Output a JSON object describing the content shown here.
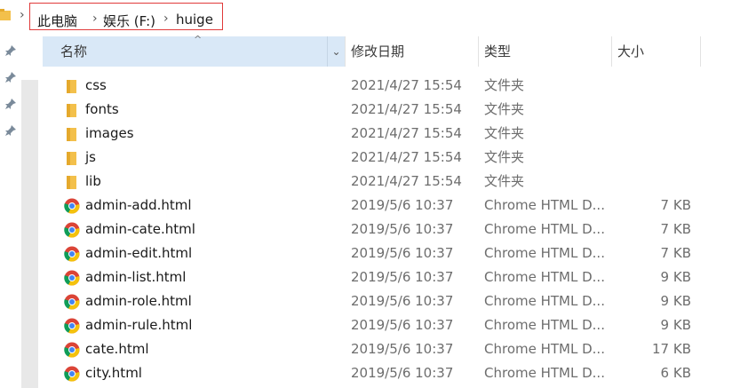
{
  "breadcrumb": {
    "items": [
      "此电脑",
      "娱乐 (F:)",
      "huige"
    ]
  },
  "columns": {
    "name": "名称",
    "modified": "修改日期",
    "type": "类型",
    "size": "大小"
  },
  "files": [
    {
      "name": "css",
      "modified": "2021/4/27 15:54",
      "type": "文件夹",
      "size": "",
      "icon": "folder-icon"
    },
    {
      "name": "fonts",
      "modified": "2021/4/27 15:54",
      "type": "文件夹",
      "size": "",
      "icon": "folder-icon"
    },
    {
      "name": "images",
      "modified": "2021/4/27 15:54",
      "type": "文件夹",
      "size": "",
      "icon": "folder-icon"
    },
    {
      "name": "js",
      "modified": "2021/4/27 15:54",
      "type": "文件夹",
      "size": "",
      "icon": "folder-icon"
    },
    {
      "name": "lib",
      "modified": "2021/4/27 15:54",
      "type": "文件夹",
      "size": "",
      "icon": "folder-icon"
    },
    {
      "name": "admin-add.html",
      "modified": "2019/5/6 10:37",
      "type": "Chrome HTML D...",
      "size": "7 KB",
      "icon": "chrome-html-icon"
    },
    {
      "name": "admin-cate.html",
      "modified": "2019/5/6 10:37",
      "type": "Chrome HTML D...",
      "size": "7 KB",
      "icon": "chrome-html-icon"
    },
    {
      "name": "admin-edit.html",
      "modified": "2019/5/6 10:37",
      "type": "Chrome HTML D...",
      "size": "7 KB",
      "icon": "chrome-html-icon"
    },
    {
      "name": "admin-list.html",
      "modified": "2019/5/6 10:37",
      "type": "Chrome HTML D...",
      "size": "9 KB",
      "icon": "chrome-html-icon"
    },
    {
      "name": "admin-role.html",
      "modified": "2019/5/6 10:37",
      "type": "Chrome HTML D...",
      "size": "9 KB",
      "icon": "chrome-html-icon"
    },
    {
      "name": "admin-rule.html",
      "modified": "2019/5/6 10:37",
      "type": "Chrome HTML D...",
      "size": "9 KB",
      "icon": "chrome-html-icon"
    },
    {
      "name": "cate.html",
      "modified": "2019/5/6 10:37",
      "type": "Chrome HTML D...",
      "size": "17 KB",
      "icon": "chrome-html-icon"
    },
    {
      "name": "city.html",
      "modified": "2019/5/6 10:37",
      "type": "Chrome HTML D...",
      "size": "6 KB",
      "icon": "chrome-html-icon"
    }
  ],
  "colors": {
    "folder": "#f3c04b",
    "header_selected": "#d9e8f7",
    "highlight_border": "#e03a3a"
  }
}
